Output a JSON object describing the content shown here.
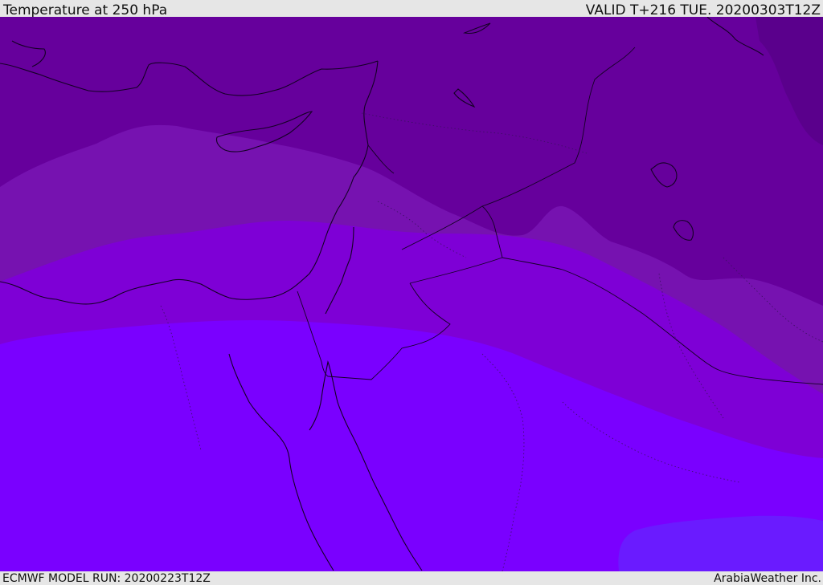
{
  "header": {
    "title": "Temperature at 250 hPa",
    "valid": "VALID T+216 TUE. 20200303T12Z"
  },
  "footer": {
    "model_run": "ECMWF MODEL RUN: 20200223T12Z",
    "credit": "ArabiaWeather Inc."
  },
  "map": {
    "colors": {
      "band_coldest": "#5a008c",
      "band_cold": "#66009c",
      "band_mid": "#7612b0",
      "band_warm": "#7e00d6",
      "band_warmer": "#7a00ff",
      "band_warmest": "#6a1bff"
    }
  }
}
